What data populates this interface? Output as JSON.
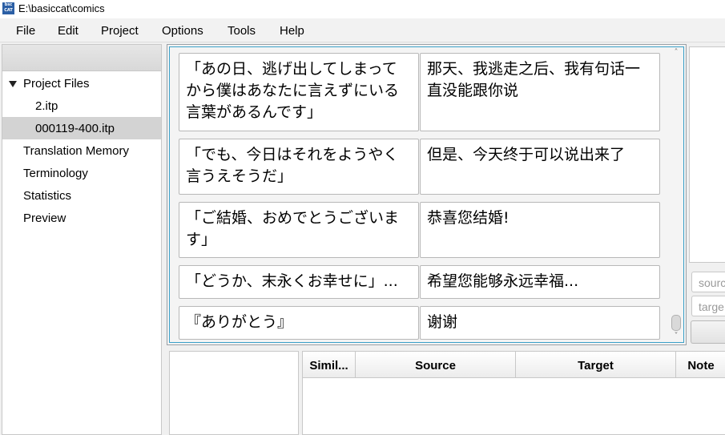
{
  "window": {
    "title": "E:\\basiccat\\comics",
    "app_icon_text": "bsc CAT"
  },
  "menu": [
    "File",
    "Edit",
    "Project",
    "Options",
    "Tools",
    "Help"
  ],
  "sidebar": {
    "project_files_label": "Project Files",
    "files": [
      "2.itp",
      "000119-400.itp"
    ],
    "selected_file_index": 1,
    "items": [
      "Translation Memory",
      "Terminology",
      "Statistics",
      "Preview"
    ]
  },
  "segments": [
    {
      "source": "「あの日、逃げ出してしまってから僕はあなたに言えずにいる言葉があるんです」",
      "target": "那天、我逃走之后、我有句话一直没能跟你说"
    },
    {
      "source": "「でも、今日はそれをようやく言うえそうだ」",
      "target": "但是、今天终于可以说出来了"
    },
    {
      "source": "「ご結婚、おめでとうございます」",
      "target": "恭喜您结婚!"
    },
    {
      "source": "「どうか、末永くお幸せに」...",
      "target": "希望您能够永远幸福..."
    },
    {
      "source": "『ありがとう』",
      "target": "谢谢"
    }
  ],
  "right_panel": {
    "source_placeholder": "sourc",
    "target_placeholder": "targe"
  },
  "match_table": {
    "columns": [
      "Simil...",
      "Source",
      "Target",
      "Note"
    ]
  }
}
